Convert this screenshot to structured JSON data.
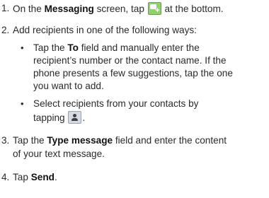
{
  "steps": [
    {
      "number": "1.",
      "pre": "On the ",
      "bold": "Messaging",
      "post_icon_before": " screen, tap ",
      "post": " at the bottom."
    },
    {
      "number": "2.",
      "text": "Add recipients in one of the following ways:",
      "bullets": [
        {
          "pre": "Tap the ",
          "bold": "To",
          "line1_rest": " field and manually enter the",
          "line2": "recipient’s number or the contact name. If the",
          "line3": "phone presents a few suggestions, tap the one",
          "line4": "you want to add."
        },
        {
          "line1": "Select recipients from your contacts by",
          "line2_pre": "tapping ",
          "line2_post": "."
        }
      ]
    },
    {
      "number": "3.",
      "pre": "Tap the ",
      "bold": "Type message",
      "line1_rest": " field and enter the content",
      "line2": "of your text message."
    },
    {
      "number": "4.",
      "pre": "Tap ",
      "bold": "Send",
      "post": "."
    }
  ],
  "icons": {
    "new_message": "new-message-icon",
    "contacts": "contacts-icon",
    "new_message_color": "#8fd16a",
    "contacts_color": "#d7dbe0"
  }
}
